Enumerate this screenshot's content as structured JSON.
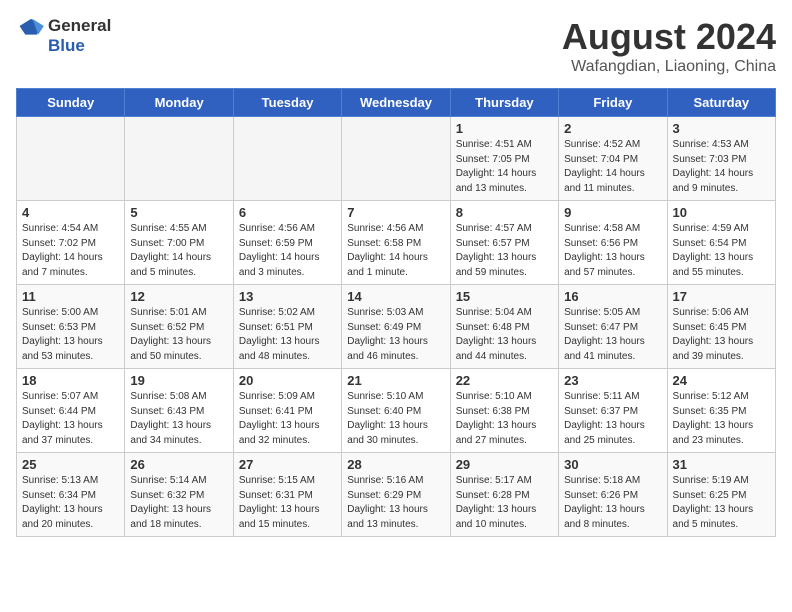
{
  "logo": {
    "general": "General",
    "blue": "Blue"
  },
  "title": "August 2024",
  "subtitle": "Wafangdian, Liaoning, China",
  "weekdays": [
    "Sunday",
    "Monday",
    "Tuesday",
    "Wednesday",
    "Thursday",
    "Friday",
    "Saturday"
  ],
  "weeks": [
    [
      {
        "day": "",
        "info": ""
      },
      {
        "day": "",
        "info": ""
      },
      {
        "day": "",
        "info": ""
      },
      {
        "day": "",
        "info": ""
      },
      {
        "day": "1",
        "info": "Sunrise: 4:51 AM\nSunset: 7:05 PM\nDaylight: 14 hours\nand 13 minutes."
      },
      {
        "day": "2",
        "info": "Sunrise: 4:52 AM\nSunset: 7:04 PM\nDaylight: 14 hours\nand 11 minutes."
      },
      {
        "day": "3",
        "info": "Sunrise: 4:53 AM\nSunset: 7:03 PM\nDaylight: 14 hours\nand 9 minutes."
      }
    ],
    [
      {
        "day": "4",
        "info": "Sunrise: 4:54 AM\nSunset: 7:02 PM\nDaylight: 14 hours\nand 7 minutes."
      },
      {
        "day": "5",
        "info": "Sunrise: 4:55 AM\nSunset: 7:00 PM\nDaylight: 14 hours\nand 5 minutes."
      },
      {
        "day": "6",
        "info": "Sunrise: 4:56 AM\nSunset: 6:59 PM\nDaylight: 14 hours\nand 3 minutes."
      },
      {
        "day": "7",
        "info": "Sunrise: 4:56 AM\nSunset: 6:58 PM\nDaylight: 14 hours\nand 1 minute."
      },
      {
        "day": "8",
        "info": "Sunrise: 4:57 AM\nSunset: 6:57 PM\nDaylight: 13 hours\nand 59 minutes."
      },
      {
        "day": "9",
        "info": "Sunrise: 4:58 AM\nSunset: 6:56 PM\nDaylight: 13 hours\nand 57 minutes."
      },
      {
        "day": "10",
        "info": "Sunrise: 4:59 AM\nSunset: 6:54 PM\nDaylight: 13 hours\nand 55 minutes."
      }
    ],
    [
      {
        "day": "11",
        "info": "Sunrise: 5:00 AM\nSunset: 6:53 PM\nDaylight: 13 hours\nand 53 minutes."
      },
      {
        "day": "12",
        "info": "Sunrise: 5:01 AM\nSunset: 6:52 PM\nDaylight: 13 hours\nand 50 minutes."
      },
      {
        "day": "13",
        "info": "Sunrise: 5:02 AM\nSunset: 6:51 PM\nDaylight: 13 hours\nand 48 minutes."
      },
      {
        "day": "14",
        "info": "Sunrise: 5:03 AM\nSunset: 6:49 PM\nDaylight: 13 hours\nand 46 minutes."
      },
      {
        "day": "15",
        "info": "Sunrise: 5:04 AM\nSunset: 6:48 PM\nDaylight: 13 hours\nand 44 minutes."
      },
      {
        "day": "16",
        "info": "Sunrise: 5:05 AM\nSunset: 6:47 PM\nDaylight: 13 hours\nand 41 minutes."
      },
      {
        "day": "17",
        "info": "Sunrise: 5:06 AM\nSunset: 6:45 PM\nDaylight: 13 hours\nand 39 minutes."
      }
    ],
    [
      {
        "day": "18",
        "info": "Sunrise: 5:07 AM\nSunset: 6:44 PM\nDaylight: 13 hours\nand 37 minutes."
      },
      {
        "day": "19",
        "info": "Sunrise: 5:08 AM\nSunset: 6:43 PM\nDaylight: 13 hours\nand 34 minutes."
      },
      {
        "day": "20",
        "info": "Sunrise: 5:09 AM\nSunset: 6:41 PM\nDaylight: 13 hours\nand 32 minutes."
      },
      {
        "day": "21",
        "info": "Sunrise: 5:10 AM\nSunset: 6:40 PM\nDaylight: 13 hours\nand 30 minutes."
      },
      {
        "day": "22",
        "info": "Sunrise: 5:10 AM\nSunset: 6:38 PM\nDaylight: 13 hours\nand 27 minutes."
      },
      {
        "day": "23",
        "info": "Sunrise: 5:11 AM\nSunset: 6:37 PM\nDaylight: 13 hours\nand 25 minutes."
      },
      {
        "day": "24",
        "info": "Sunrise: 5:12 AM\nSunset: 6:35 PM\nDaylight: 13 hours\nand 23 minutes."
      }
    ],
    [
      {
        "day": "25",
        "info": "Sunrise: 5:13 AM\nSunset: 6:34 PM\nDaylight: 13 hours\nand 20 minutes."
      },
      {
        "day": "26",
        "info": "Sunrise: 5:14 AM\nSunset: 6:32 PM\nDaylight: 13 hours\nand 18 minutes."
      },
      {
        "day": "27",
        "info": "Sunrise: 5:15 AM\nSunset: 6:31 PM\nDaylight: 13 hours\nand 15 minutes."
      },
      {
        "day": "28",
        "info": "Sunrise: 5:16 AM\nSunset: 6:29 PM\nDaylight: 13 hours\nand 13 minutes."
      },
      {
        "day": "29",
        "info": "Sunrise: 5:17 AM\nSunset: 6:28 PM\nDaylight: 13 hours\nand 10 minutes."
      },
      {
        "day": "30",
        "info": "Sunrise: 5:18 AM\nSunset: 6:26 PM\nDaylight: 13 hours\nand 8 minutes."
      },
      {
        "day": "31",
        "info": "Sunrise: 5:19 AM\nSunset: 6:25 PM\nDaylight: 13 hours\nand 5 minutes."
      }
    ]
  ]
}
